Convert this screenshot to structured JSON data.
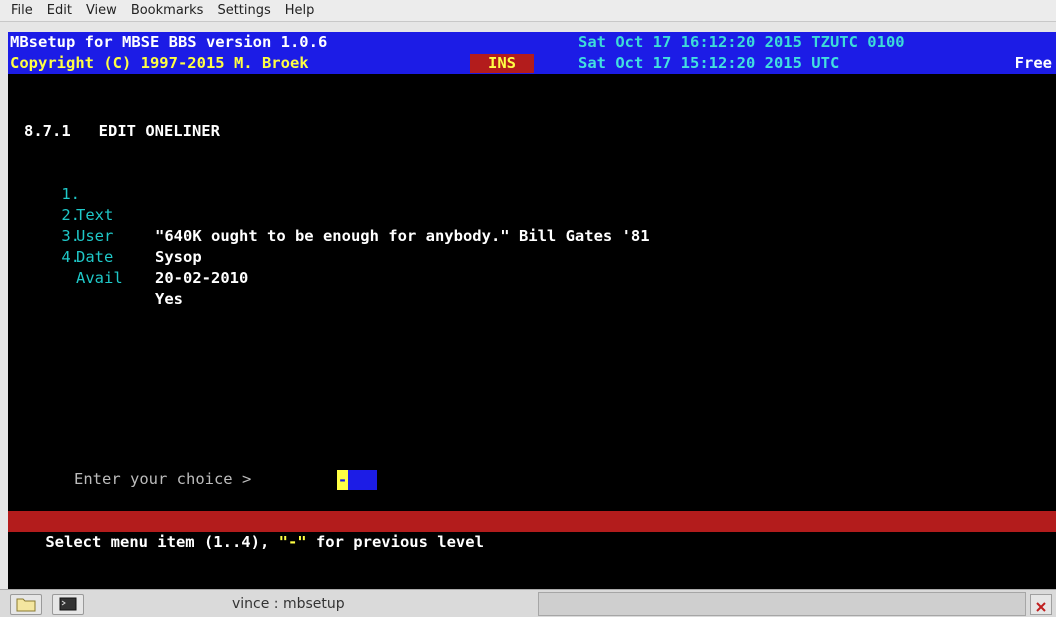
{
  "menubar": {
    "items": [
      "File",
      "Edit",
      "View",
      "Bookmarks",
      "Settings",
      "Help"
    ]
  },
  "terminal": {
    "header_line1_left": "MBsetup for MBSE BBS version 1.0.6",
    "header_line1_right": "Sat Oct 17 16:12:20 2015 TZUTC 0100",
    "header_line2_left": "Copyright (C) 1997-2015 M. Broek",
    "ins_label": "INS",
    "header_line2_right": "Sat Oct 17 15:12:20 2015 UTC",
    "free_label": "Free",
    "screen_title": "8.7.1   EDIT ONELINER",
    "fields": [
      {
        "num": "1.",
        "label": "Text",
        "value": "\"640K ought to be enough for anybody.\" Bill Gates '81"
      },
      {
        "num": "2.",
        "label": "User",
        "value": "Sysop"
      },
      {
        "num": "3.",
        "label": "Date",
        "value": "20-02-2010"
      },
      {
        "num": "4.",
        "label": "Avail",
        "value": "Yes"
      }
    ],
    "prompt": "Enter your choice > ",
    "input_value": "-",
    "status_prefix": "Select menu item (1..4), ",
    "status_quote": "\"-\"",
    "status_suffix": " for previous level"
  },
  "taskbar": {
    "task_label": "vince : mbsetup"
  },
  "colors": {
    "header_bg": "#1c1ce6",
    "status_bg": "#b31c1c",
    "field_label": "#1fc8c8",
    "yellow": "#ffff44"
  }
}
